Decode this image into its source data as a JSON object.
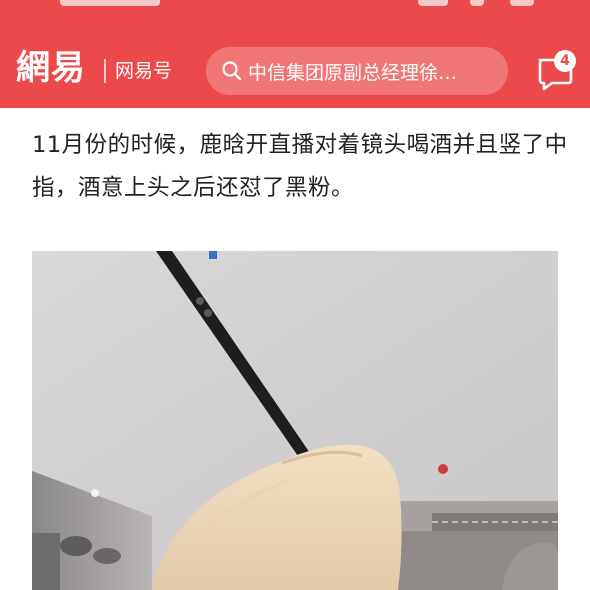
{
  "header": {
    "logo_text": "網易",
    "channel_label": "网易号",
    "search_text": "中信集团原副总经理徐…",
    "message_badge_count": "4",
    "brand_color": "#ec4a4a",
    "icons": [
      "search-icon",
      "message-icon"
    ]
  },
  "article": {
    "paragraph": "11月份的时候，鹿晗开直播对着镜头喝酒并且竖了中指，酒意上头之后还怼了黑粉。"
  }
}
